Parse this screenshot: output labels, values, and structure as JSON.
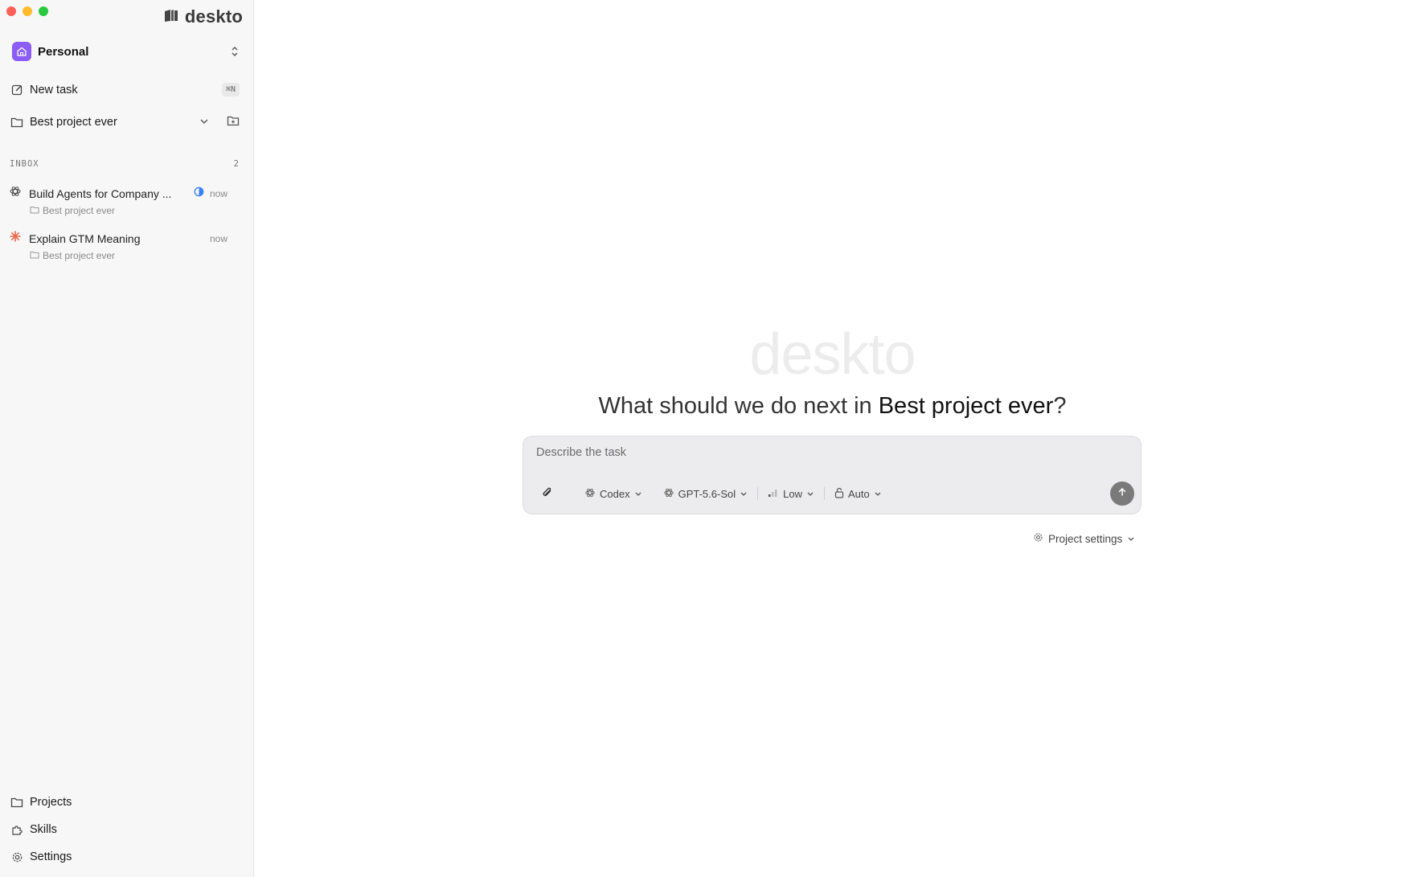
{
  "window": {
    "controls": [
      "close",
      "minimize",
      "zoom"
    ]
  },
  "sidebar": {
    "brand": {
      "name": "deskto",
      "icon": "books-icon"
    },
    "workspace": {
      "name": "Personal",
      "icon": "home-icon",
      "accent": "#8b5cf6"
    },
    "new_task": {
      "label": "New task",
      "shortcut": "⌘N",
      "icon": "compose-icon"
    },
    "project": {
      "name": "Best project ever",
      "icon": "folder-icon"
    },
    "inbox": {
      "label": "INBOX",
      "count": "2",
      "tasks": [
        {
          "title": "Build Agents for Company ...",
          "time": "now",
          "project": "Best project ever",
          "agent_icon": "openai-icon",
          "status_icon": "half-circle-icon",
          "status_color": "#3b82f6"
        },
        {
          "title": "Explain GTM Meaning",
          "time": "now",
          "project": "Best project ever",
          "agent_icon": "asterisk-icon",
          "agent_color": "#e8674a"
        }
      ]
    },
    "bottom_nav": [
      {
        "label": "Projects",
        "icon": "folder-icon"
      },
      {
        "label": "Skills",
        "icon": "puzzle-icon"
      },
      {
        "label": "Settings",
        "icon": "gear-icon"
      }
    ]
  },
  "main": {
    "watermark": "deskto",
    "headline_prefix": "What should we do next in ",
    "headline_project": "Best project ever",
    "headline_suffix": "?",
    "composer": {
      "placeholder": "Describe the task",
      "agent": "Codex",
      "model": "GPT-5.6-Sol",
      "effort": "Low",
      "permission": "Auto"
    },
    "project_settings": "Project settings"
  }
}
